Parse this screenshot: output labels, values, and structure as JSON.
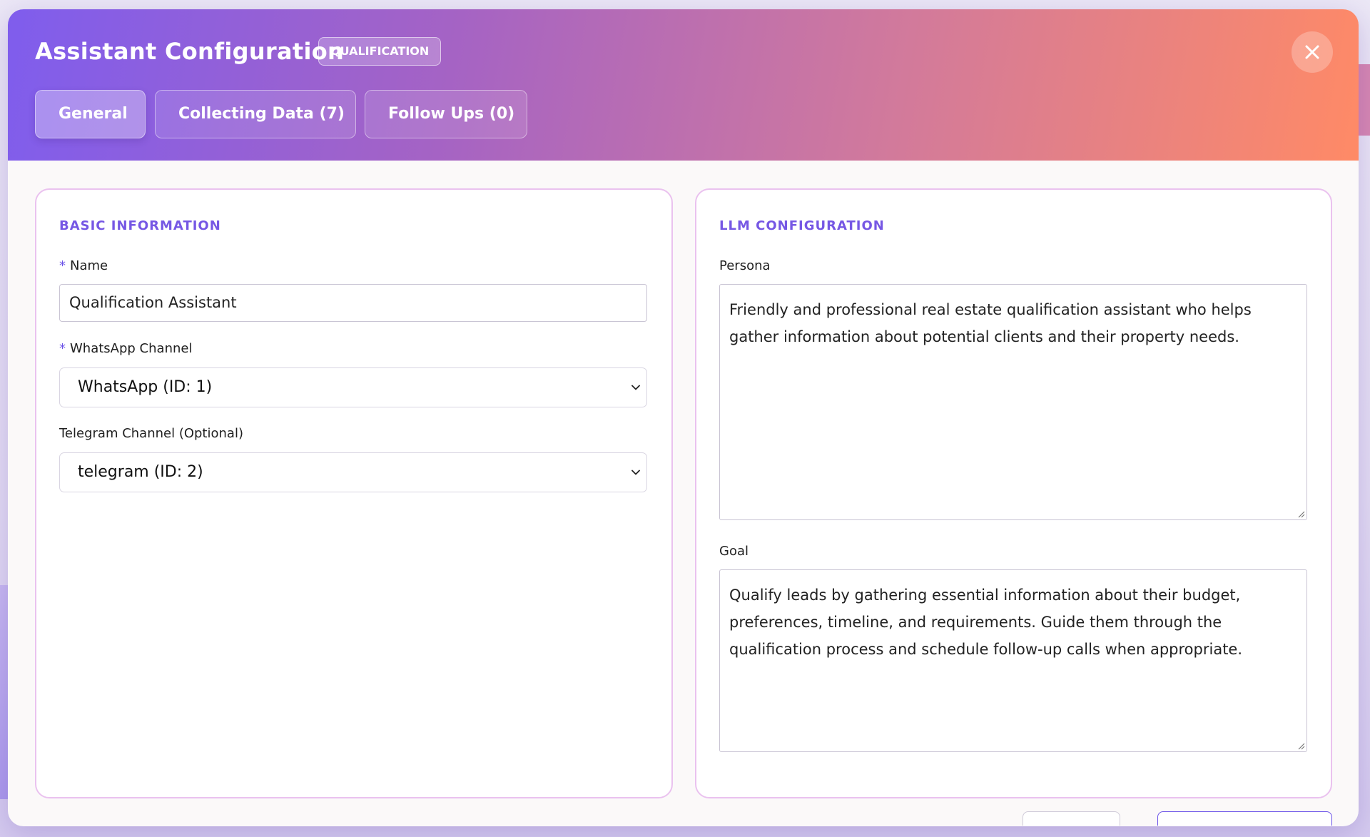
{
  "header": {
    "title": "Assistant Configuration",
    "badge": "QUALIFICATION",
    "gradient_colors": [
      "#7f5ded",
      "#a563c4",
      "#d27a9b",
      "#ff8a66"
    ]
  },
  "tabs": [
    {
      "label": "General",
      "active": true
    },
    {
      "label": "Collecting Data (7)",
      "active": false
    },
    {
      "label": "Follow Ups (0)",
      "active": false
    }
  ],
  "basic": {
    "section_title": "BASIC INFORMATION",
    "name_label": "Name",
    "name_required": "*",
    "name_value": "Qualification Assistant",
    "whatsapp_label": "WhatsApp Channel",
    "whatsapp_required": "*",
    "whatsapp_value": "WhatsApp (ID: 1)",
    "telegram_label": "Telegram Channel (Optional)",
    "telegram_value": "telegram (ID: 2)"
  },
  "llm": {
    "section_title": "LLM CONFIGURATION",
    "persona_label": "Persona",
    "persona_value": "Friendly and professional real estate qualification assistant who helps gather information about potential clients and their property needs.",
    "goal_label": "Goal",
    "goal_value": "Qualify leads by gathering essential information about their budget, preferences, timeline, and requirements. Guide them through the qualification process and schedule follow-up calls when appropriate."
  },
  "icons": {
    "close": "close-icon",
    "dropdown": "chevron-down-icon",
    "resize": "resize-grip-icon"
  },
  "colors": {
    "accent": "#7657e4",
    "panel_border": "#eac2ef"
  }
}
